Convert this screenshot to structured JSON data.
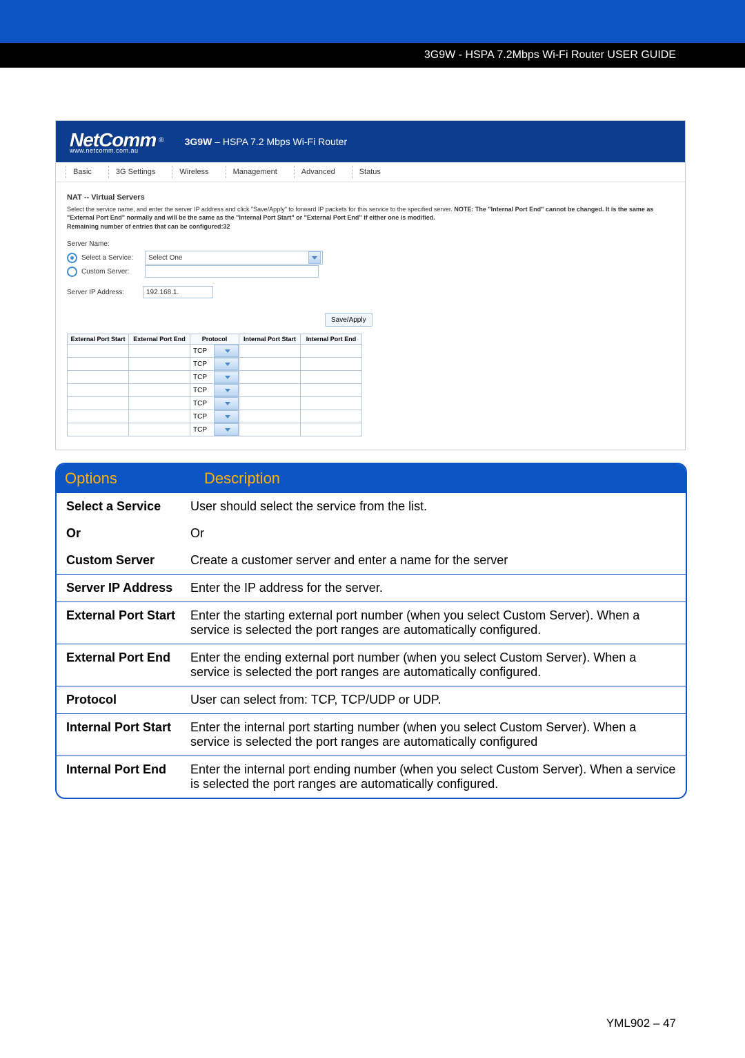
{
  "header": {
    "guide_title": "3G9W - HSPA 7.2Mbps Wi-Fi Router USER GUIDE"
  },
  "router": {
    "brand": "NetComm",
    "brand_url": "www.netcomm.com.au",
    "model": "3G9W",
    "subtitle": "– HSPA 7.2 Mbps Wi-Fi Router",
    "nav": [
      "Basic",
      "3G Settings",
      "Wireless",
      "Management",
      "Advanced",
      "Status"
    ],
    "page_title": "NAT -- Virtual Servers",
    "desc_1": "Select the service name, and enter the server IP address and click \"Save/Apply\" to forward IP packets for this service to the specified server. ",
    "desc_note": "NOTE: The \"Internal Port End\" cannot be changed. It is the same as \"External Port End\" normally and will be the same as the \"Internal Port Start\" or \"External Port End\" if either one is modified.",
    "remaining_label": "Remaining number of entries that can be configured:",
    "remaining_value": "32",
    "server_name_label": "Server Name:",
    "select_service_label": "Select a Service:",
    "select_service_value": "Select One",
    "custom_server_label": "Custom Server:",
    "server_ip_label": "Server IP Address:",
    "server_ip_value": "192.168.1.",
    "save_label": "Save/Apply",
    "port_headers": [
      "External Port Start",
      "External Port End",
      "Protocol",
      "Internal Port Start",
      "Internal Port End"
    ],
    "protocol_value": "TCP",
    "row_count": 7
  },
  "options": {
    "head_option": "Options",
    "head_desc": "Description",
    "rows": [
      {
        "o": "Select a Service",
        "d": "User should select the service from the list."
      },
      {
        "o": "Or",
        "d": "Or"
      },
      {
        "o": "Custom Server",
        "d": "Create a customer server and enter a name for the server"
      },
      {
        "o": "Server IP Address",
        "d": "Enter the IP address for the server."
      },
      {
        "o": "External Port Start",
        "d": "Enter the starting external port number (when you select Custom Server). When a service is selected the port ranges are automatically configured."
      },
      {
        "o": "External Port End",
        "d": "Enter the ending external port number (when you select Custom Server). When a service is selected the port ranges are automatically configured."
      },
      {
        "o": "Protocol",
        "d": "User can select from: TCP, TCP/UDP or UDP."
      },
      {
        "o": "Internal Port Start",
        "d": "Enter the internal port starting number (when you select Custom Server). When a service is selected the port ranges are automatically configured"
      },
      {
        "o": "Internal Port End",
        "d": "Enter the internal port ending number (when you select Custom Server). When a service is selected the port ranges are automatically configured."
      }
    ]
  },
  "footer": {
    "page": "YML902 – 47"
  }
}
